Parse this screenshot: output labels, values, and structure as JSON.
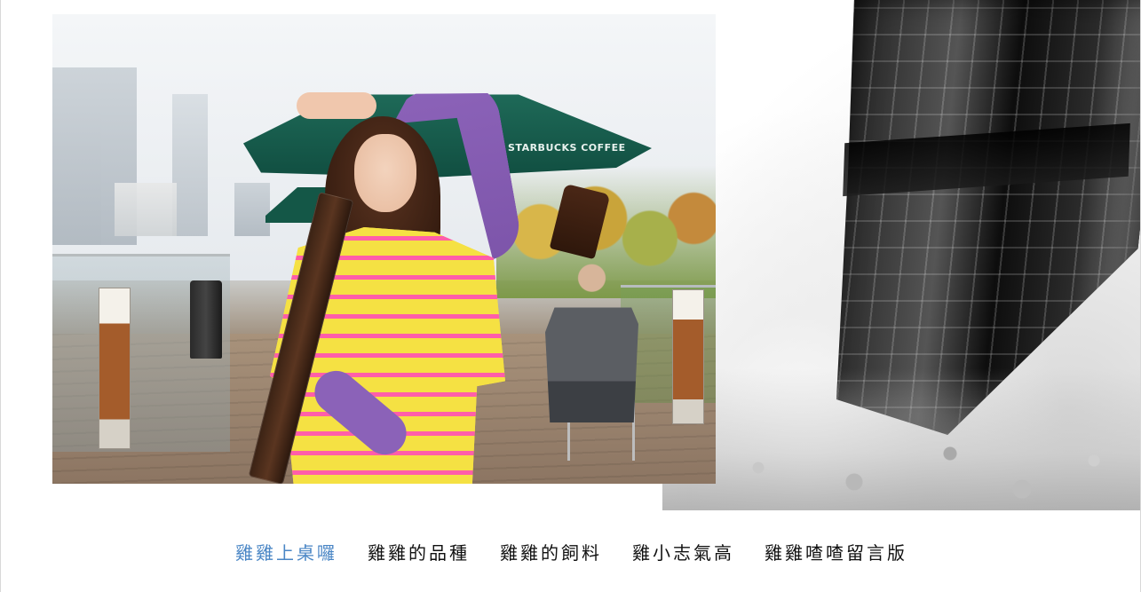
{
  "banner": {
    "photo_sign_text": "STARBUCKS COFFEE",
    "right_art": "stormy-skyscraper-artwork"
  },
  "nav": {
    "items": [
      {
        "label": "雞雞上桌囉",
        "active": true
      },
      {
        "label": "雞雞的品種",
        "active": false
      },
      {
        "label": "雞雞的飼料",
        "active": false
      },
      {
        "label": "雞小志氣高",
        "active": false
      },
      {
        "label": "雞雞喳喳留言版",
        "active": false
      }
    ]
  },
  "colors": {
    "nav_active": "#4a86c5",
    "nav_default": "#111111",
    "page_bg": "#ffffff"
  }
}
